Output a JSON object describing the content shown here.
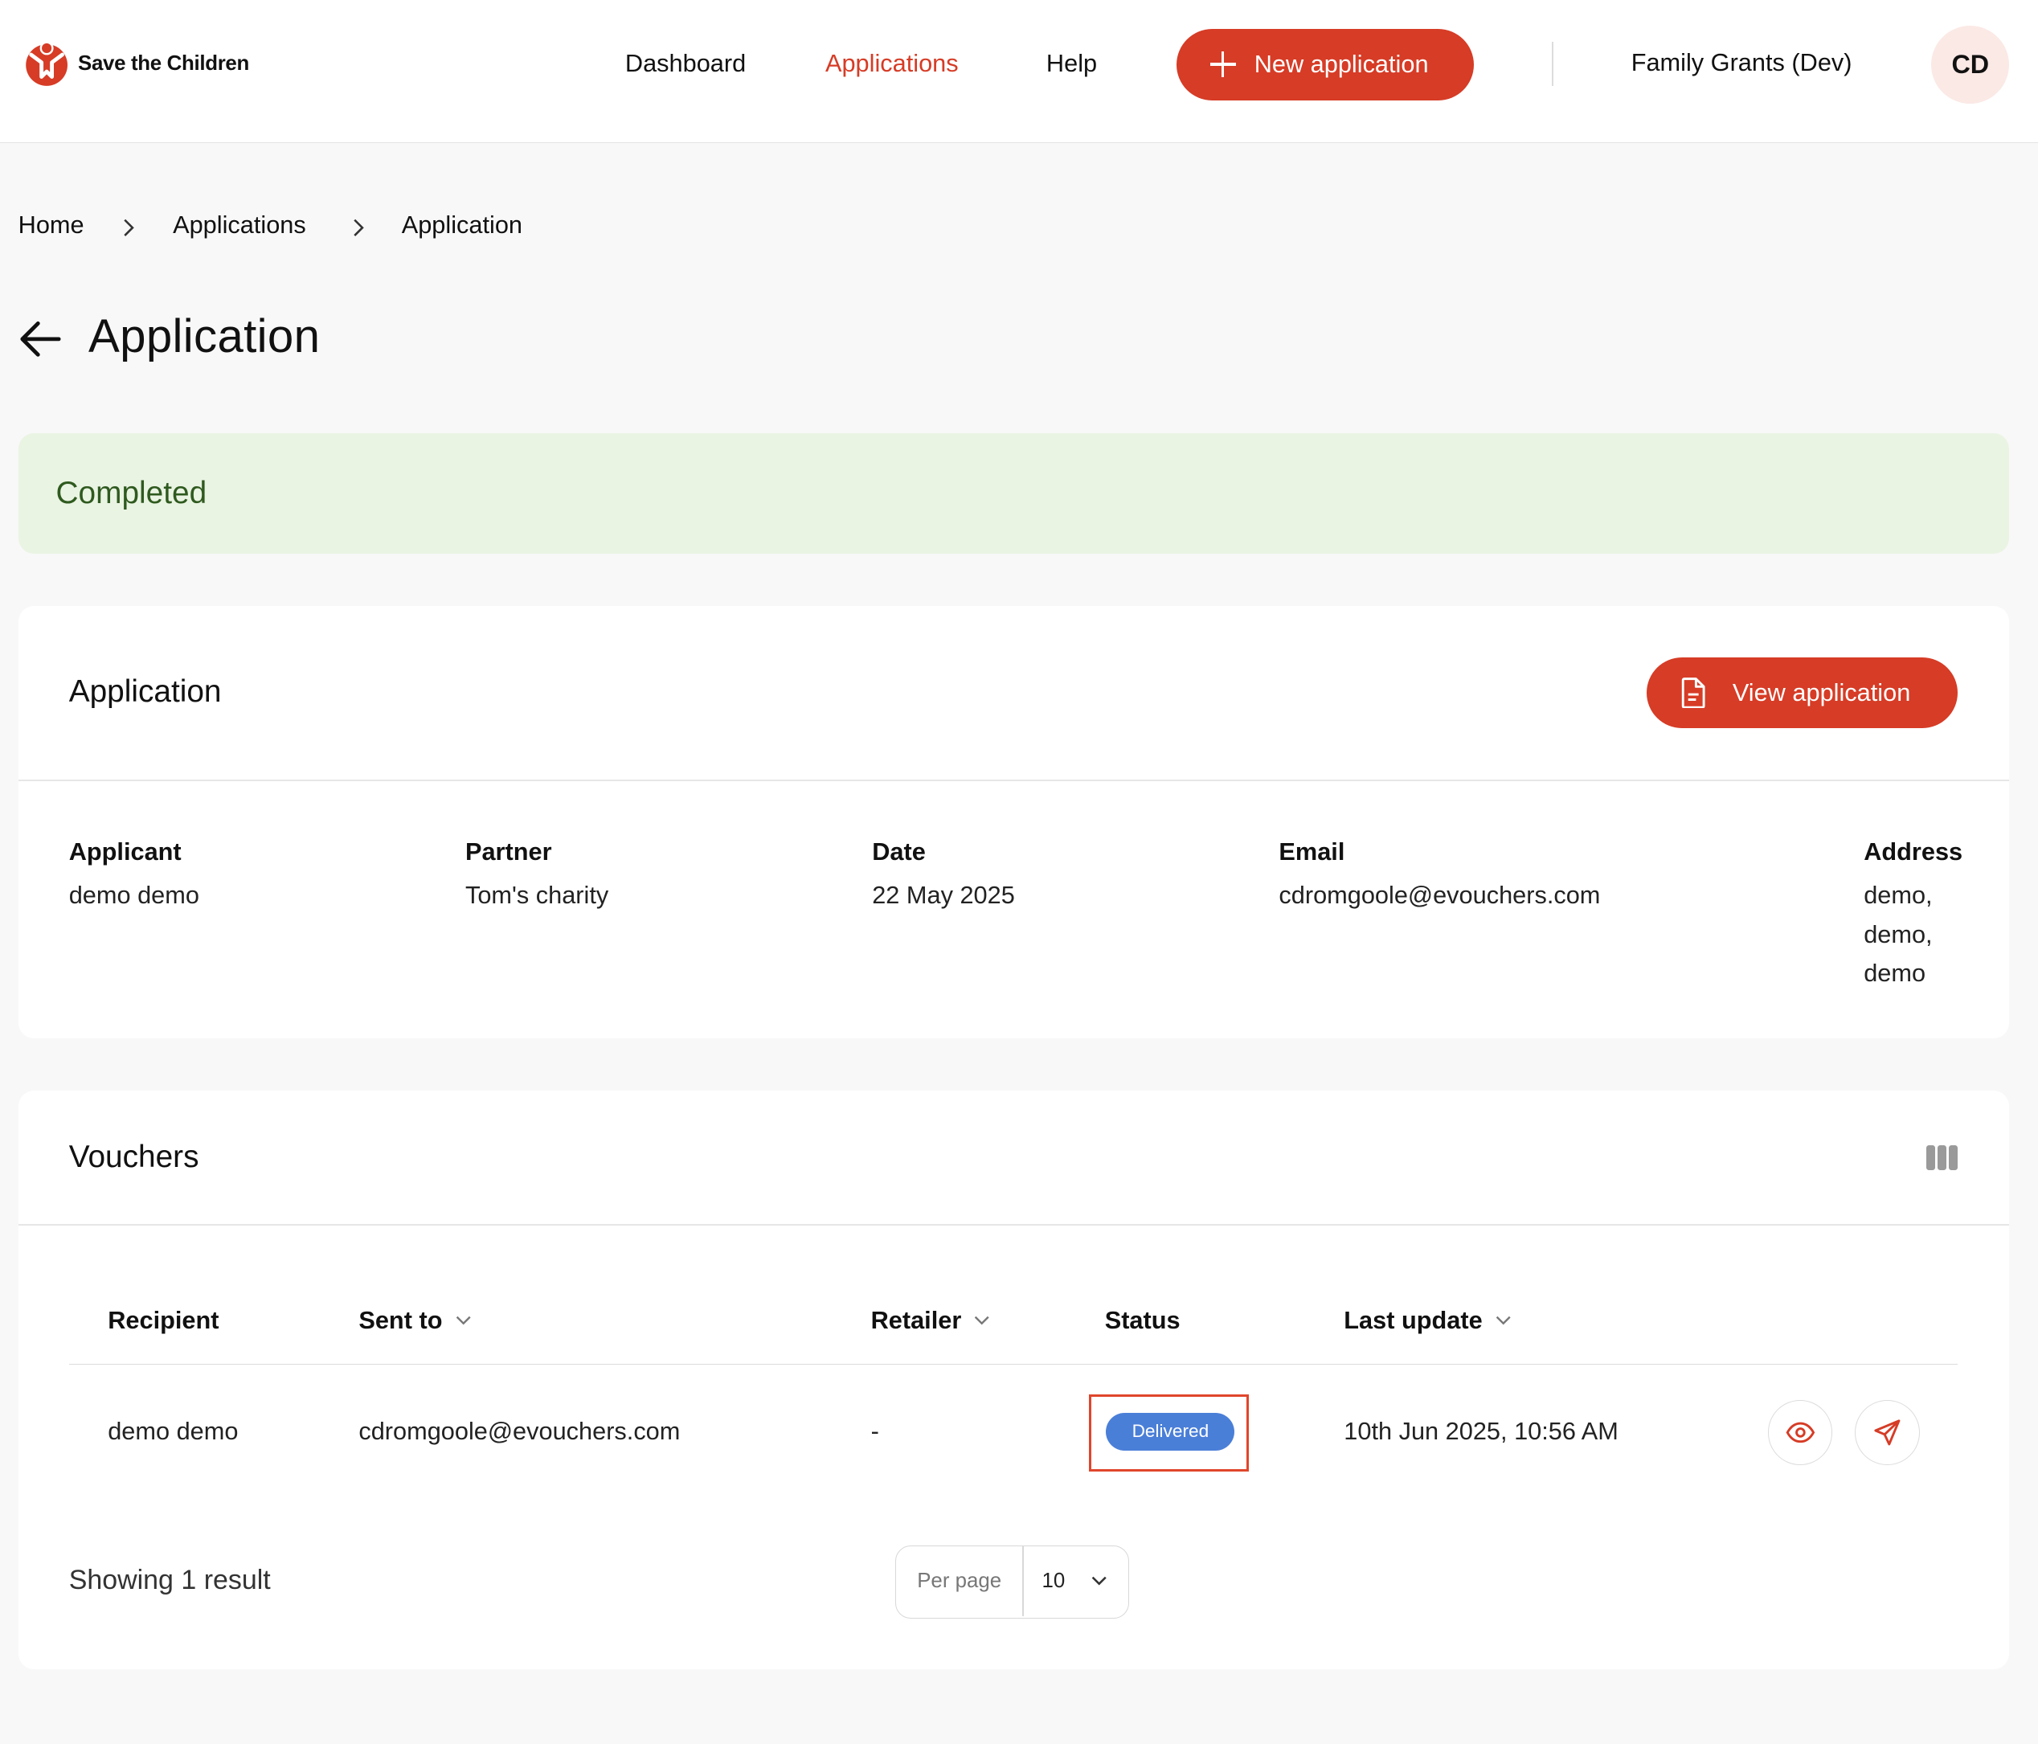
{
  "header": {
    "brand": "Save the Children",
    "nav": [
      {
        "label": "Dashboard",
        "active": false
      },
      {
        "label": "Applications",
        "active": true
      },
      {
        "label": "Help",
        "active": false
      }
    ],
    "new_application_label": "New application",
    "organisation": "Family Grants (Dev)",
    "avatar_initials": "CD"
  },
  "breadcrumb": [
    "Home",
    "Applications",
    "Application"
  ],
  "page": {
    "title": "Application",
    "status": "Completed"
  },
  "application_card": {
    "title": "Application",
    "view_button_label": "View application",
    "fields": [
      {
        "label": "Applicant",
        "value": "demo demo"
      },
      {
        "label": "Partner",
        "value": "Tom's charity"
      },
      {
        "label": "Date",
        "value": "22 May 2025"
      },
      {
        "label": "Email",
        "value": "cdromgoole@evouchers.com"
      },
      {
        "label": "Address",
        "lines": [
          "demo,",
          "demo,",
          "demo"
        ]
      }
    ]
  },
  "vouchers_card": {
    "title": "Vouchers",
    "columns": [
      "Recipient",
      "Sent to",
      "Retailer",
      "Status",
      "Last update"
    ],
    "rows": [
      {
        "recipient": "demo demo",
        "sent_to": "cdromgoole@evouchers.com",
        "retailer": "-",
        "status": "Delivered",
        "last_update": "10th Jun 2025, 10:56 AM"
      }
    ],
    "showing_text": "Showing 1 result",
    "per_page_label": "Per page",
    "per_page_value": "10"
  },
  "colors": {
    "accent": "#d63c26",
    "status_banner_bg": "#eaf4e3",
    "status_banner_text": "#2f5a1f",
    "badge_delivered": "#4a7fd8",
    "highlight_box": "#e0462c"
  },
  "icons": [
    "brand-logo-icon",
    "plus-icon",
    "chevron-right-icon",
    "back-arrow-icon",
    "document-icon",
    "columns-icon",
    "chevron-down-icon",
    "eye-icon",
    "send-icon"
  ]
}
